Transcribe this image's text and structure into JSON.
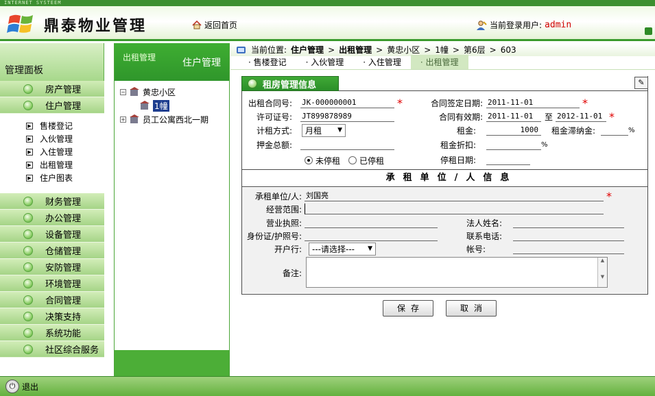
{
  "header": {
    "strip_text": "INTERNET SYSTEEM",
    "app_title": "鼎泰物业管理",
    "home_link": "返回首页",
    "user_label": "当前登录用户:",
    "user_name": "admin"
  },
  "sidebar": {
    "panel_title": "管理面板",
    "menu_top": [
      {
        "label": "房产管理"
      },
      {
        "label": "住户管理"
      }
    ],
    "sub_items": [
      {
        "label": "售楼登记"
      },
      {
        "label": "入伙管理"
      },
      {
        "label": "入住管理"
      },
      {
        "label": "出租管理"
      },
      {
        "label": "住户图表"
      }
    ],
    "menu_bottom": [
      {
        "label": "财务管理"
      },
      {
        "label": "办公管理"
      },
      {
        "label": "设备管理"
      },
      {
        "label": "仓储管理"
      },
      {
        "label": "安防管理"
      },
      {
        "label": "环境管理"
      },
      {
        "label": "合同管理"
      },
      {
        "label": "决策支持"
      },
      {
        "label": "系统功能"
      },
      {
        "label": "社区综合服务"
      }
    ],
    "logout": "退出"
  },
  "tree": {
    "head_small": "出租管理",
    "head_big": "住户管理",
    "nodes": [
      {
        "label": "黄忠小区",
        "toggle": "−"
      },
      {
        "label": "1幢"
      },
      {
        "label": "员工公寓西北一期",
        "toggle": "+"
      }
    ]
  },
  "main": {
    "breadcrumb": {
      "prefix": "当前位置:",
      "seg1": "住户管理",
      "seg2": "出租管理",
      "seg3": "黄忠小区",
      "seg4": "1幢",
      "seg5": "第6层",
      "seg6": "603",
      "sep": ">"
    },
    "tabs": [
      {
        "label": "· 售楼登记"
      },
      {
        "label": "· 入伙管理"
      },
      {
        "label": "· 入住管理"
      },
      {
        "label": "· 出租管理"
      }
    ],
    "panel_title": "租房管理信息",
    "form": {
      "contract_no_label": "出租合同号:",
      "contract_no": "JK-000000001",
      "sign_date_label": "合同签定日期:",
      "sign_date": "2011-11-01",
      "permit_label": "许可证号:",
      "permit": "JT899878989",
      "valid_label": "合同有效期:",
      "valid_from": "2011-11-01",
      "valid_to_sep": "至",
      "valid_to": "2012-11-01",
      "billing_label": "计租方式:",
      "billing": "月租",
      "rent_label": "租金:",
      "rent": "1000",
      "late_fee_label": "租金滞纳金:",
      "percent": "%",
      "deposit_label": "押金总额:",
      "discount_label": "租金折扣:",
      "radio_active": "未停租",
      "radio_stopped": "已停租",
      "stop_date_label": "停租日期:"
    },
    "section_title": "承租单位/人信息",
    "lower": {
      "tenant_label": "承租单位/人:",
      "tenant": "刘国亮",
      "scope_label": "经营范围:",
      "license_label": "营业执照:",
      "legal_label": "法人姓名:",
      "id_label": "身份证/护照号:",
      "phone_label": "联系电话:",
      "bank_label": "开户行:",
      "bank_select": "---请选择---",
      "account_label": "帐号:",
      "remark_label": "备注:"
    },
    "buttons": {
      "save": "保存",
      "cancel": "取消"
    }
  },
  "colors": {
    "accent": "#3a9a2c",
    "required": "#e00000",
    "user_name": "#d00000"
  }
}
